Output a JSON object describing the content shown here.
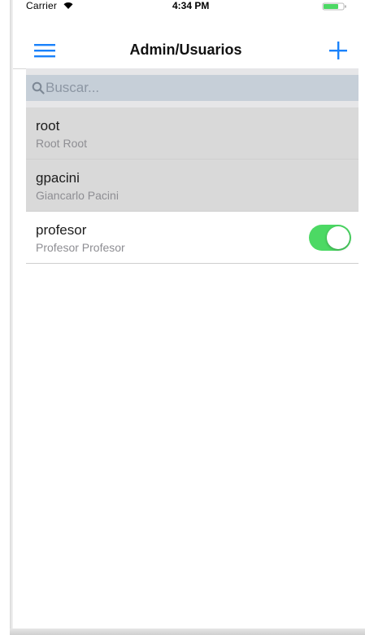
{
  "status_bar": {
    "carrier": "Carrier",
    "time": "4:34 PM",
    "wifi_icon": "wifi-icon",
    "battery_icon": "battery-icon"
  },
  "nav": {
    "title": "Admin/Usuarios",
    "menu_icon": "hamburger-menu-icon",
    "add_icon": "plus-icon",
    "accent_color": "#1a82fb"
  },
  "search": {
    "placeholder": "Buscar...",
    "value": "",
    "icon": "search-icon"
  },
  "users": [
    {
      "username": "root",
      "full_name": "Root Root",
      "selected": true
    },
    {
      "username": "gpacini",
      "full_name": "Giancarlo Pacini",
      "selected": true
    },
    {
      "username": "profesor",
      "full_name": "Profesor Profesor",
      "selected": false,
      "toggle_on": true
    }
  ],
  "colors": {
    "toggle_on": "#4cd964",
    "selected_row": "#d9d9d9",
    "search_field": "#c6cfd8"
  }
}
